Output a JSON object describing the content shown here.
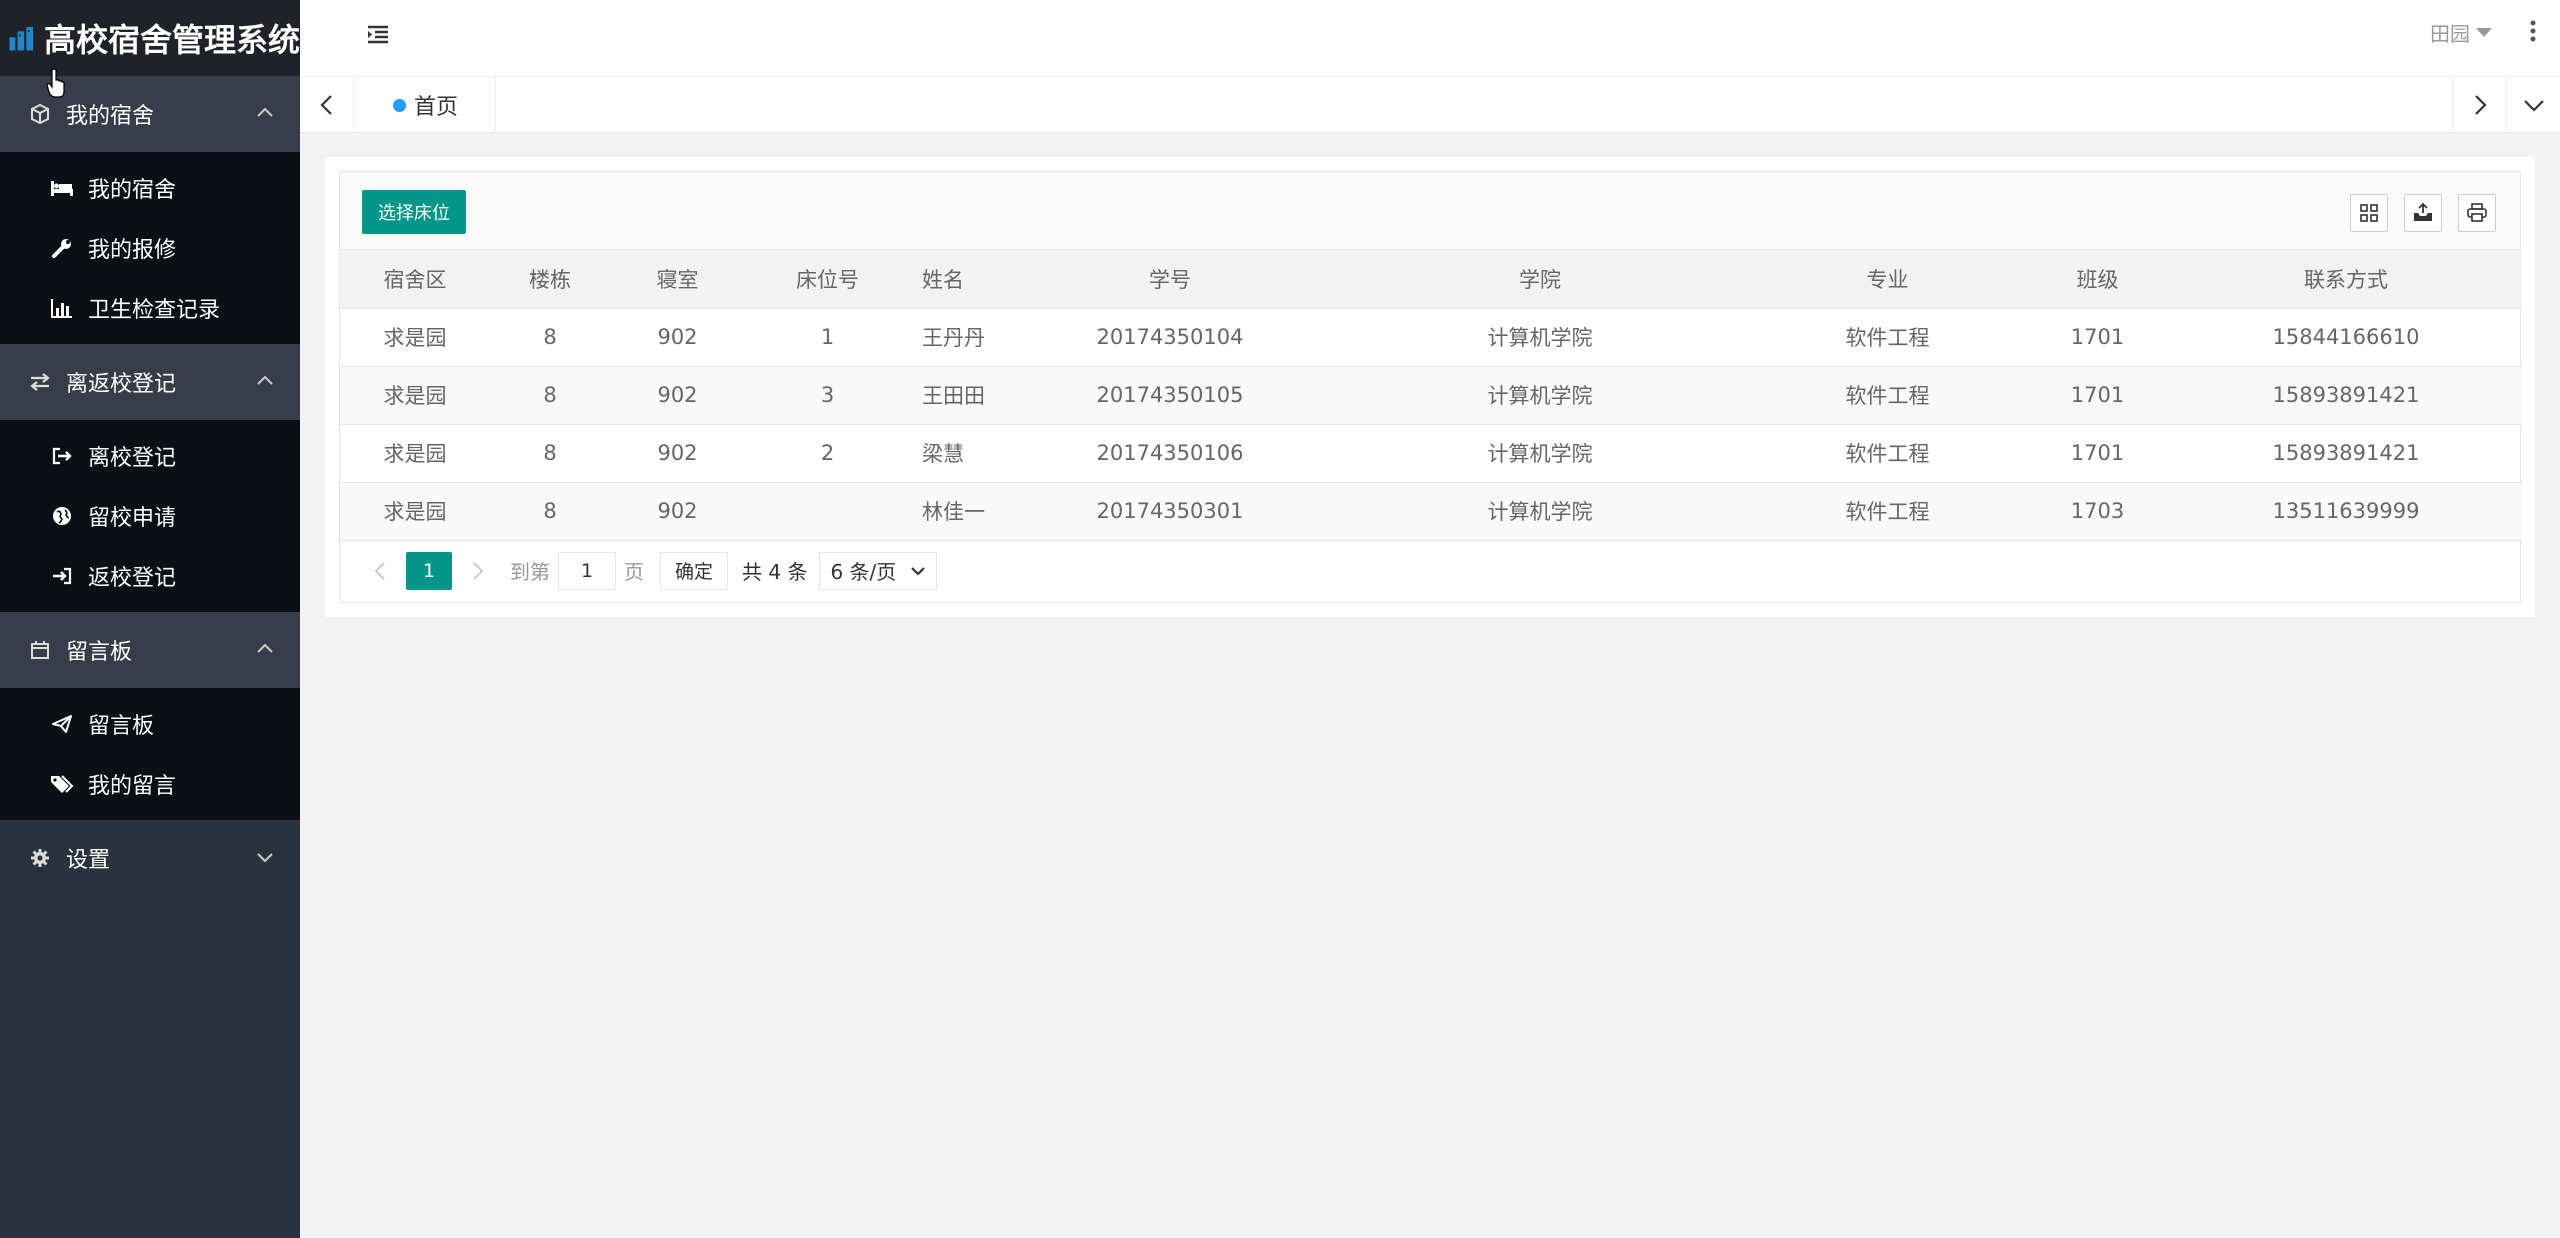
{
  "app": {
    "title": "高校宿舍管理系统"
  },
  "sidebar": {
    "groups": [
      {
        "label": "我的宿舍",
        "icon": "cube-icon",
        "expanded": true,
        "items": [
          {
            "label": "我的宿舍",
            "icon": "bed-icon"
          },
          {
            "label": "我的报修",
            "icon": "wrench-icon"
          },
          {
            "label": "卫生检查记录",
            "icon": "bar-chart-icon"
          }
        ]
      },
      {
        "label": "离返校登记",
        "icon": "exchange-icon",
        "expanded": true,
        "items": [
          {
            "label": "离校登记",
            "icon": "sign-out-icon"
          },
          {
            "label": "留校申请",
            "icon": "globe-icon"
          },
          {
            "label": "返校登记",
            "icon": "sign-in-icon"
          }
        ]
      },
      {
        "label": "留言板",
        "icon": "calendar-icon",
        "expanded": true,
        "items": [
          {
            "label": "留言板",
            "icon": "paper-plane-icon"
          },
          {
            "label": "我的留言",
            "icon": "tags-icon"
          }
        ]
      },
      {
        "label": "设置",
        "icon": "gear-icon",
        "expanded": false,
        "items": []
      }
    ]
  },
  "header": {
    "user": "田园"
  },
  "tabs": {
    "home": "首页"
  },
  "toolbar": {
    "select_bed": "选择床位"
  },
  "table": {
    "columns": [
      "宿舍区",
      "楼栋",
      "寝室",
      "床位号",
      "姓名",
      "学号",
      "学院",
      "专业",
      "班级",
      "联系方式"
    ],
    "rows": [
      [
        "求是园",
        "8",
        "902",
        "1",
        "王丹丹",
        "20174350104",
        "计算机学院",
        "软件工程",
        "1701",
        "15844166610"
      ],
      [
        "求是园",
        "8",
        "902",
        "3",
        "王田田",
        "20174350105",
        "计算机学院",
        "软件工程",
        "1701",
        "15893891421"
      ],
      [
        "求是园",
        "8",
        "902",
        "2",
        "梁慧",
        "20174350106",
        "计算机学院",
        "软件工程",
        "1701",
        "15893891421"
      ],
      [
        "求是园",
        "8",
        "902",
        "",
        "林佳一",
        "20174350301",
        "计算机学院",
        "软件工程",
        "1703",
        "13511639999"
      ]
    ]
  },
  "pager": {
    "current": "1",
    "goto_label": "到第",
    "goto_value": "1",
    "page_label": "页",
    "ok_label": "确定",
    "total": "共 4 条",
    "page_size": "6 条/页"
  },
  "colors": {
    "accent": "#009688",
    "sidebar": "#28333e",
    "tab_dot": "#1e9fff"
  }
}
